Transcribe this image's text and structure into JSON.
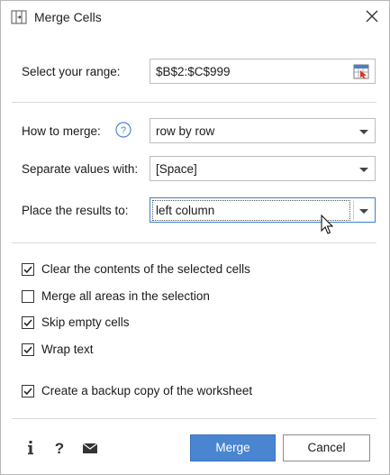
{
  "window": {
    "title": "Merge Cells",
    "icon": "merge-cells-icon"
  },
  "range": {
    "label": "Select your range:",
    "value": "$B$2:$C$999",
    "icon": "range-select-icon"
  },
  "how_to_merge": {
    "label": "How to merge:",
    "value": "row by row",
    "help_icon": "question-icon"
  },
  "separator": {
    "label": "Separate values with:",
    "value": "[Space]"
  },
  "place_results": {
    "label": "Place the results to:",
    "value": "left column"
  },
  "options": [
    {
      "label": "Clear the contents of the selected cells",
      "checked": true
    },
    {
      "label": "Merge all areas in the selection",
      "checked": false
    },
    {
      "label": "Skip empty cells",
      "checked": true
    },
    {
      "label": "Wrap text",
      "checked": true
    },
    {
      "label": "Create a backup copy of the worksheet",
      "checked": true
    }
  ],
  "footer": {
    "info_icon": "info-icon",
    "help_icon": "question-icon",
    "mail_icon": "envelope-icon",
    "merge_label": "Merge",
    "cancel_label": "Cancel"
  },
  "colors": {
    "primary": "#4a85d1",
    "focus_border": "#3c7fd1"
  }
}
